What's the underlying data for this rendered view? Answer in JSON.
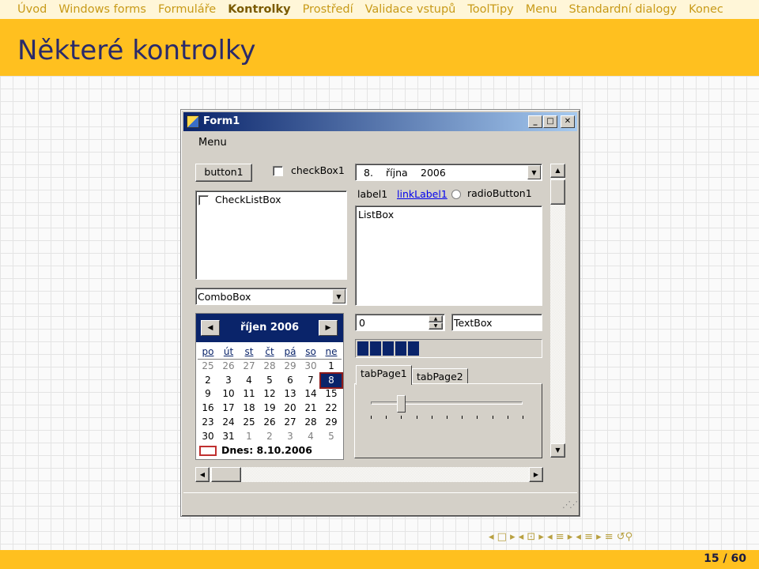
{
  "nav": {
    "items": [
      "Úvod",
      "Windows forms",
      "Formuláře",
      "Kontrolky",
      "Prostředí",
      "Validace vstupů",
      "ToolTipy",
      "Menu",
      "Standardní dialogy",
      "Konec"
    ],
    "active_index": 3
  },
  "slide": {
    "title": "Některé kontrolky",
    "page": "15 / 60",
    "beamer_nav": "◂ □ ▸ ◂ ⊡ ▸ ◂ ≡ ▸ ◂ ≡ ▸ ≡ ↺⚲"
  },
  "form": {
    "title": "Form1",
    "minimize": "_",
    "maximize": "□",
    "close": "✕",
    "menu": "Menu",
    "button1": "button1",
    "checkbox1": "checkBox1",
    "datepicker": {
      "day": "8.",
      "month": "října",
      "year": "2006"
    },
    "checklistbox_item": "CheckListBox",
    "label1": "label1",
    "linklabel1": "linkLabel1",
    "radiobutton1": "radioButton1",
    "listbox_item": "ListBox",
    "combobox": "ComboBox",
    "calendar": {
      "month": "říjen 2006",
      "days_of_week": [
        "po",
        "út",
        "st",
        "čt",
        "pá",
        "so",
        "ne"
      ],
      "weeks": [
        [
          "25",
          "26",
          "27",
          "28",
          "29",
          "30",
          "1"
        ],
        [
          "2",
          "3",
          "4",
          "5",
          "6",
          "7",
          "8"
        ],
        [
          "9",
          "10",
          "11",
          "12",
          "13",
          "14",
          "15"
        ],
        [
          "16",
          "17",
          "18",
          "19",
          "20",
          "21",
          "22"
        ],
        [
          "23",
          "24",
          "25",
          "26",
          "27",
          "28",
          "29"
        ],
        [
          "30",
          "31",
          "1",
          "2",
          "3",
          "4",
          "5"
        ]
      ],
      "selected": "8",
      "today": "Dnes: 8.10.2006"
    },
    "numeric_updown": "0",
    "textbox": "TextBox",
    "progress_blocks": 5,
    "tab1": "tabPage1",
    "tab2": "tabPage2",
    "trackbar": {
      "value": 2,
      "max": 10
    }
  },
  "colors": {
    "nav_bg": "#fff6d8",
    "title_bg": "#ffc01f",
    "title_text": "#2a2a6a",
    "win_title": "#0a246a",
    "face": "#d4d0c8"
  }
}
